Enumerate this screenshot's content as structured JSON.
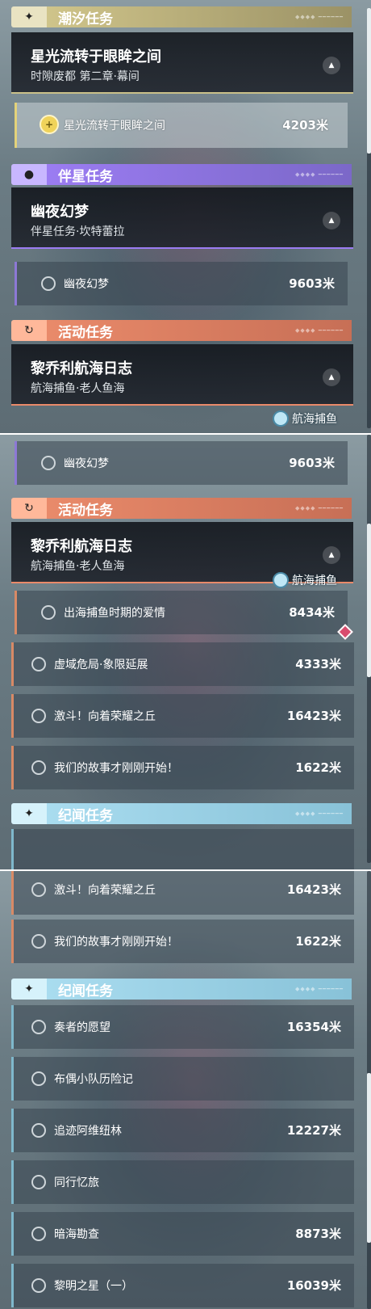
{
  "panels": [
    {
      "categories": [
        {
          "label": "潮汐任务",
          "icon": "star-sparkle-icon",
          "badge": "✦"
        },
        {
          "label": "伴星任务",
          "icon": "companion-icon",
          "badge": "●"
        },
        {
          "label": "活动任务",
          "icon": "event-refresh-icon",
          "badge": "↻"
        }
      ],
      "cards": [
        {
          "title": "星光流转于眼眸之间",
          "subtitle": "时隙废都 第二章·幕间"
        },
        {
          "title": "幽夜幻梦",
          "subtitle": "伴星任务·坎特蕾拉"
        },
        {
          "title": "黎乔利航海日志",
          "subtitle": "航海捕鱼·老人鱼海"
        }
      ],
      "rows": [
        {
          "name": "星光流转于眼眸之间",
          "distance": "4203米"
        },
        {
          "name": "幽夜幻梦",
          "distance": "9603米"
        }
      ],
      "map_tag": "航海捕鱼"
    },
    {
      "categories": [
        {
          "label": "活动任务",
          "icon": "event-refresh-icon",
          "badge": "↻"
        },
        {
          "label": "纪闻任务",
          "icon": "star-sparkle-icon",
          "badge": "✦"
        }
      ],
      "cards": [
        {
          "title": "黎乔利航海日志",
          "subtitle": "航海捕鱼·老人鱼海"
        }
      ],
      "rows": [
        {
          "name": "幽夜幻梦",
          "distance": "9603米"
        },
        {
          "name": "出海捕鱼时期的爱情",
          "distance": "8434米"
        },
        {
          "name": "虚域危局·象限延展",
          "distance": "4333米"
        },
        {
          "name": "激斗！向着荣耀之丘",
          "distance": "16423米"
        },
        {
          "name": "我们的故事才刚刚开始！",
          "distance": "1622米"
        }
      ],
      "map_tag": "航海捕鱼"
    },
    {
      "categories": [
        {
          "label": "纪闻任务",
          "icon": "star-sparkle-icon",
          "badge": "✦"
        }
      ],
      "rows": [
        {
          "name": "激斗！向着荣耀之丘",
          "distance": "16423米"
        },
        {
          "name": "我们的故事才刚刚开始！",
          "distance": "1622米"
        },
        {
          "name": "奏者的愿望",
          "distance": "16354米"
        },
        {
          "name": "布偶小队历险记",
          "distance": ""
        },
        {
          "name": "追迹阿维纽林",
          "distance": "12227米"
        },
        {
          "name": "同行忆旅",
          "distance": ""
        },
        {
          "name": "暗海勘查",
          "distance": "8873米"
        },
        {
          "name": "黎明之星（一）",
          "distance": "16039米"
        }
      ]
    }
  ],
  "colors": {
    "tide": "#cfc48a",
    "companion": "#9b7cf2",
    "event": "#e98a6a",
    "chronicle": "#a9dcef"
  }
}
